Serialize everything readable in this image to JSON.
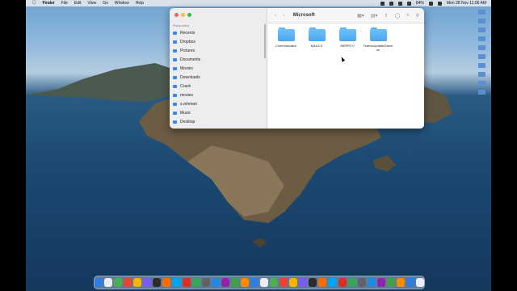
{
  "menubar": {
    "app_name": "Finder",
    "menus": [
      "File",
      "Edit",
      "View",
      "Go",
      "Window",
      "Help"
    ],
    "battery": "64%",
    "clock": "Mon 28 Nov 11:06 AM"
  },
  "finder": {
    "title": "Microsoft",
    "sidebar_header": "Favourites",
    "sidebar_items": [
      {
        "label": "Recents",
        "icon": "clock-icon"
      },
      {
        "label": "Dropbox",
        "icon": "dropbox-icon"
      },
      {
        "label": "Pictures",
        "icon": "pictures-icon"
      },
      {
        "label": "Documents",
        "icon": "documents-icon"
      },
      {
        "label": "Movies",
        "icon": "movies-icon"
      },
      {
        "label": "Downloads",
        "icon": "downloads-icon"
      },
      {
        "label": "Crack",
        "icon": "folder-icon"
      },
      {
        "label": "movies",
        "icon": "folder-icon"
      },
      {
        "label": "s.rehman",
        "icon": "home-icon"
      },
      {
        "label": "Music",
        "icon": "music-icon"
      },
      {
        "label": "Desktop",
        "icon": "desktop-icon"
      }
    ],
    "files": [
      {
        "name": "Communicator"
      },
      {
        "name": "MAU2.0"
      },
      {
        "name": "MERP2.0"
      },
      {
        "name": "TeamsUpdaterDaemon"
      }
    ]
  },
  "colors": {
    "folder_blue": "#4aa7ee",
    "accent_blue": "#3b86e8"
  },
  "dock_count": 34
}
